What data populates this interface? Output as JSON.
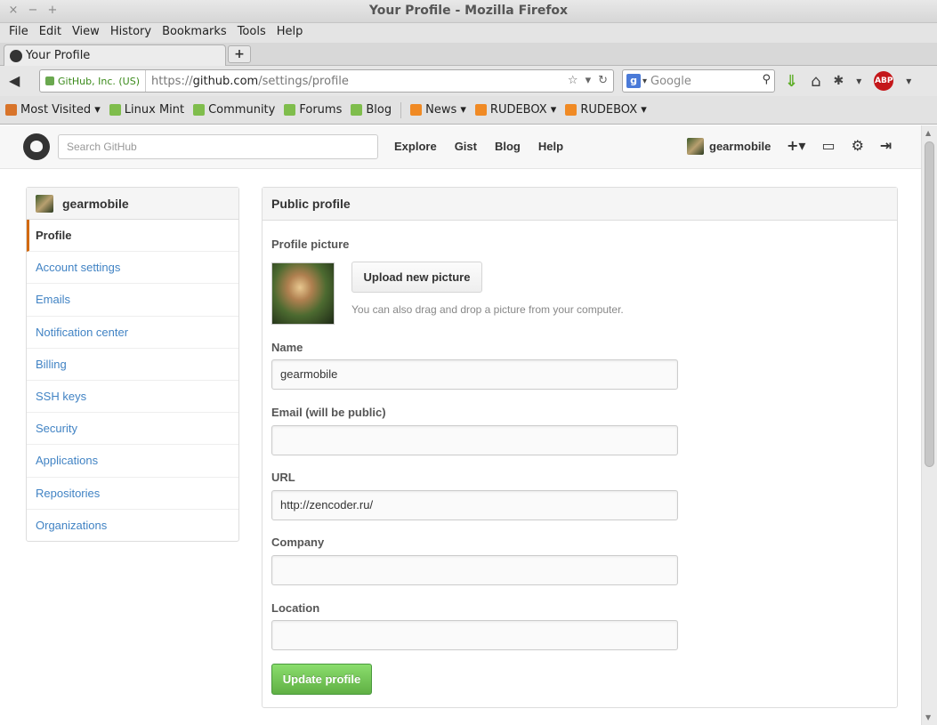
{
  "window": {
    "title": "Your Profile - Mozilla Firefox",
    "controls": [
      "×",
      "−",
      "+"
    ]
  },
  "menu": [
    "File",
    "Edit",
    "View",
    "History",
    "Bookmarks",
    "Tools",
    "Help"
  ],
  "tab": {
    "title": "Your Profile",
    "new_tab": "+"
  },
  "nav": {
    "identity": "GitHub, Inc. (US)",
    "url_scheme": "https://",
    "url_host": "github.com",
    "url_path": "/settings/profile",
    "search_placeholder": "Google"
  },
  "bookmarks": [
    {
      "label": "Most Visited ▾",
      "kind": "mv"
    },
    {
      "label": "Linux Mint",
      "kind": "mint"
    },
    {
      "label": "Community",
      "kind": "mint"
    },
    {
      "label": "Forums",
      "kind": "mint"
    },
    {
      "label": "Blog",
      "kind": "mint"
    },
    {
      "label": "News ▾",
      "kind": "rss"
    },
    {
      "label": "RUDEBOX ▾",
      "kind": "rss"
    },
    {
      "label": "RUDEBOX ▾",
      "kind": "rss"
    }
  ],
  "gh": {
    "search_placeholder": "Search GitHub",
    "nav": [
      "Explore",
      "Gist",
      "Blog",
      "Help"
    ],
    "username": "gearmobile",
    "icons": [
      "+▾",
      "inbox-icon",
      "gear-icon",
      "signout-icon"
    ]
  },
  "sidebar": {
    "username": "gearmobile",
    "items": [
      "Profile",
      "Account settings",
      "Emails",
      "Notification center",
      "Billing",
      "SSH keys",
      "Security",
      "Applications",
      "Repositories",
      "Organizations"
    ],
    "active": "Profile"
  },
  "profile": {
    "heading": "Public profile",
    "picture_label": "Profile picture",
    "upload_label": "Upload new picture",
    "hint": "You can also drag and drop a picture from your computer.",
    "name_label": "Name",
    "name_value": "gearmobile",
    "email_label": "Email (will be public)",
    "email_value": "",
    "url_label": "URL",
    "url_value": "http://zencoder.ru/",
    "company_label": "Company",
    "company_value": "",
    "location_label": "Location",
    "location_value": "",
    "submit_label": "Update profile"
  },
  "colors": {
    "link": "#4183c4",
    "active_marker": "#d26911",
    "submit": "#60b044"
  }
}
